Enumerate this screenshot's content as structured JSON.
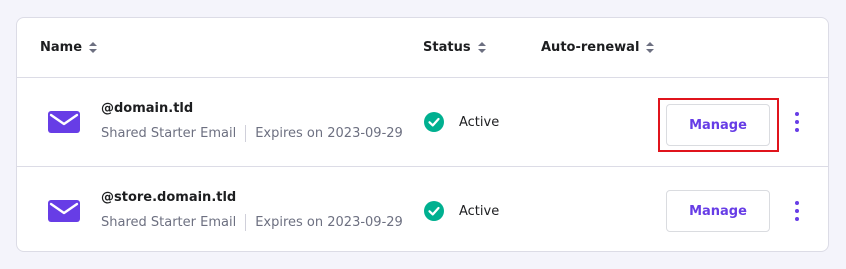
{
  "table": {
    "columns": [
      {
        "label": "Name"
      },
      {
        "label": "Status"
      },
      {
        "label": "Auto-renewal"
      }
    ],
    "rows": [
      {
        "domain": "@domain.tld",
        "plan": "Shared Starter Email",
        "expires": "Expires on 2023-09-29",
        "status": "Active",
        "action_label": "Manage",
        "highlighted": true
      },
      {
        "domain": "@store.domain.tld",
        "plan": "Shared Starter Email",
        "expires": "Expires on 2023-09-29",
        "status": "Active",
        "action_label": "Manage",
        "highlighted": false
      }
    ]
  },
  "icons": {
    "row_icon": "email-envelope-icon",
    "status_icon": "check-circle-icon",
    "sort_icon": "sort-arrows-icon",
    "more_icon": "kebab-menu-icon"
  },
  "colors": {
    "accent": "#673de6",
    "success": "#00b090",
    "highlight": "#e0141c",
    "text": "#1d1e20",
    "muted": "#6d7081"
  }
}
